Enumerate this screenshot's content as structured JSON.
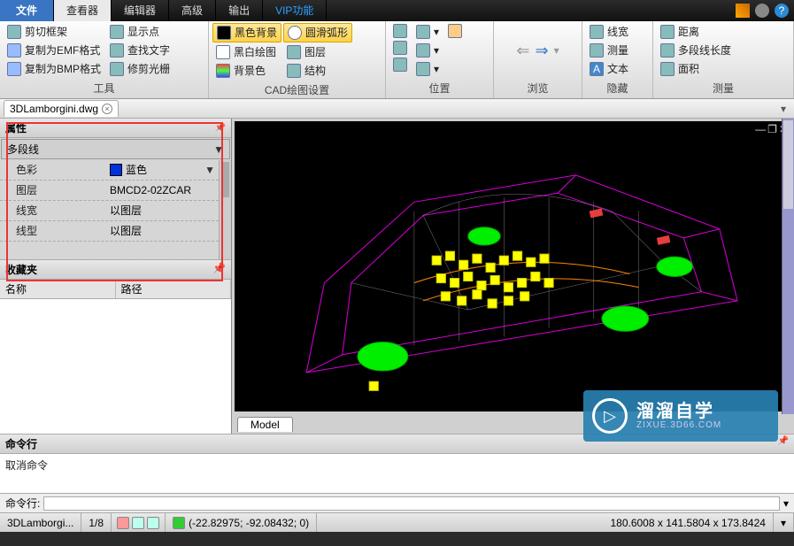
{
  "titlebar": {
    "tabs": [
      "文件",
      "查看器",
      "编辑器",
      "高级",
      "输出",
      "VIP功能"
    ]
  },
  "ribbon": {
    "tools": {
      "label": "工具",
      "items": [
        "剪切框架",
        "复制为EMF格式",
        "复制为BMP格式",
        "显示点",
        "查找文字",
        "修剪光栅"
      ]
    },
    "cad": {
      "label": "CAD绘图设置",
      "items": [
        "黑色背景",
        "黑白绘图",
        "背景色",
        "圆滑弧形",
        "图层",
        "结构"
      ]
    },
    "position": {
      "label": "位置"
    },
    "browse": {
      "label": "浏览"
    },
    "hide": {
      "label": "隐藏",
      "items": [
        "线宽",
        "测量",
        "文本"
      ]
    },
    "measure": {
      "label": "测量",
      "items": [
        "距离",
        "多段线长度",
        "面积"
      ]
    }
  },
  "doc": {
    "name": "3DLamborgini.dwg"
  },
  "props": {
    "title": "属性",
    "type": "多段线",
    "rows": {
      "color_k": "色彩",
      "color_v": "蓝色",
      "layer_k": "图层",
      "layer_v": "BMCD2-02ZCAR",
      "linewidth_k": "线宽",
      "linewidth_v": "以图层",
      "linetype_k": "线型",
      "linetype_v": "以图层"
    }
  },
  "fav": {
    "title": "收藏夹",
    "col1": "名称",
    "col2": "路径"
  },
  "model_tab": "Model",
  "cmd": {
    "title": "命令行",
    "line": "取消命令",
    "prompt": "命令行:"
  },
  "watermark": {
    "t1": "溜溜自学",
    "t2": "ZIXUE.3D66.COM"
  },
  "status": {
    "file": "3DLamborgi...",
    "scale": "1/8",
    "coords": "(-22.82975; -92.08432; 0)",
    "dims": "180.6008 x 141.5804 x 173.8424"
  }
}
